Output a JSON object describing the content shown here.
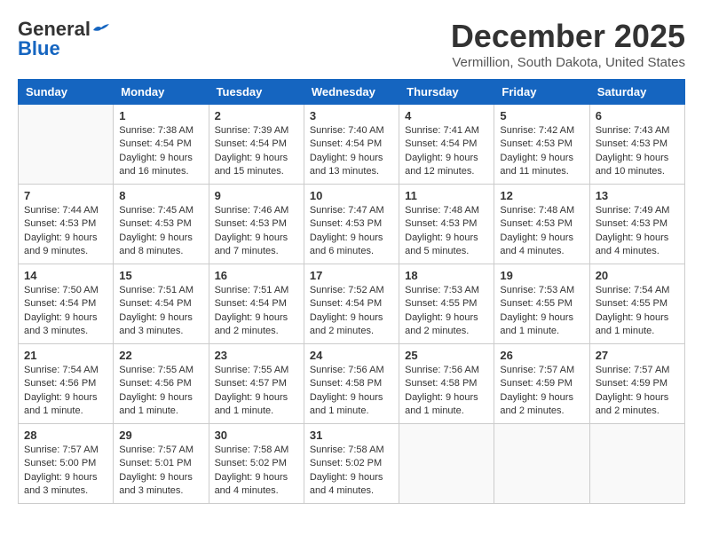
{
  "header": {
    "logo_general": "General",
    "logo_blue": "Blue",
    "month_title": "December 2025",
    "subtitle": "Vermillion, South Dakota, United States"
  },
  "days_of_week": [
    "Sunday",
    "Monday",
    "Tuesday",
    "Wednesday",
    "Thursday",
    "Friday",
    "Saturday"
  ],
  "weeks": [
    [
      {
        "day": "",
        "sunrise": "",
        "sunset": "",
        "daylight": ""
      },
      {
        "day": "1",
        "sunrise": "Sunrise: 7:38 AM",
        "sunset": "Sunset: 4:54 PM",
        "daylight": "Daylight: 9 hours and 16 minutes."
      },
      {
        "day": "2",
        "sunrise": "Sunrise: 7:39 AM",
        "sunset": "Sunset: 4:54 PM",
        "daylight": "Daylight: 9 hours and 15 minutes."
      },
      {
        "day": "3",
        "sunrise": "Sunrise: 7:40 AM",
        "sunset": "Sunset: 4:54 PM",
        "daylight": "Daylight: 9 hours and 13 minutes."
      },
      {
        "day": "4",
        "sunrise": "Sunrise: 7:41 AM",
        "sunset": "Sunset: 4:54 PM",
        "daylight": "Daylight: 9 hours and 12 minutes."
      },
      {
        "day": "5",
        "sunrise": "Sunrise: 7:42 AM",
        "sunset": "Sunset: 4:53 PM",
        "daylight": "Daylight: 9 hours and 11 minutes."
      },
      {
        "day": "6",
        "sunrise": "Sunrise: 7:43 AM",
        "sunset": "Sunset: 4:53 PM",
        "daylight": "Daylight: 9 hours and 10 minutes."
      }
    ],
    [
      {
        "day": "7",
        "sunrise": "Sunrise: 7:44 AM",
        "sunset": "Sunset: 4:53 PM",
        "daylight": "Daylight: 9 hours and 9 minutes."
      },
      {
        "day": "8",
        "sunrise": "Sunrise: 7:45 AM",
        "sunset": "Sunset: 4:53 PM",
        "daylight": "Daylight: 9 hours and 8 minutes."
      },
      {
        "day": "9",
        "sunrise": "Sunrise: 7:46 AM",
        "sunset": "Sunset: 4:53 PM",
        "daylight": "Daylight: 9 hours and 7 minutes."
      },
      {
        "day": "10",
        "sunrise": "Sunrise: 7:47 AM",
        "sunset": "Sunset: 4:53 PM",
        "daylight": "Daylight: 9 hours and 6 minutes."
      },
      {
        "day": "11",
        "sunrise": "Sunrise: 7:48 AM",
        "sunset": "Sunset: 4:53 PM",
        "daylight": "Daylight: 9 hours and 5 minutes."
      },
      {
        "day": "12",
        "sunrise": "Sunrise: 7:48 AM",
        "sunset": "Sunset: 4:53 PM",
        "daylight": "Daylight: 9 hours and 4 minutes."
      },
      {
        "day": "13",
        "sunrise": "Sunrise: 7:49 AM",
        "sunset": "Sunset: 4:53 PM",
        "daylight": "Daylight: 9 hours and 4 minutes."
      }
    ],
    [
      {
        "day": "14",
        "sunrise": "Sunrise: 7:50 AM",
        "sunset": "Sunset: 4:54 PM",
        "daylight": "Daylight: 9 hours and 3 minutes."
      },
      {
        "day": "15",
        "sunrise": "Sunrise: 7:51 AM",
        "sunset": "Sunset: 4:54 PM",
        "daylight": "Daylight: 9 hours and 3 minutes."
      },
      {
        "day": "16",
        "sunrise": "Sunrise: 7:51 AM",
        "sunset": "Sunset: 4:54 PM",
        "daylight": "Daylight: 9 hours and 2 minutes."
      },
      {
        "day": "17",
        "sunrise": "Sunrise: 7:52 AM",
        "sunset": "Sunset: 4:54 PM",
        "daylight": "Daylight: 9 hours and 2 minutes."
      },
      {
        "day": "18",
        "sunrise": "Sunrise: 7:53 AM",
        "sunset": "Sunset: 4:55 PM",
        "daylight": "Daylight: 9 hours and 2 minutes."
      },
      {
        "day": "19",
        "sunrise": "Sunrise: 7:53 AM",
        "sunset": "Sunset: 4:55 PM",
        "daylight": "Daylight: 9 hours and 1 minute."
      },
      {
        "day": "20",
        "sunrise": "Sunrise: 7:54 AM",
        "sunset": "Sunset: 4:55 PM",
        "daylight": "Daylight: 9 hours and 1 minute."
      }
    ],
    [
      {
        "day": "21",
        "sunrise": "Sunrise: 7:54 AM",
        "sunset": "Sunset: 4:56 PM",
        "daylight": "Daylight: 9 hours and 1 minute."
      },
      {
        "day": "22",
        "sunrise": "Sunrise: 7:55 AM",
        "sunset": "Sunset: 4:56 PM",
        "daylight": "Daylight: 9 hours and 1 minute."
      },
      {
        "day": "23",
        "sunrise": "Sunrise: 7:55 AM",
        "sunset": "Sunset: 4:57 PM",
        "daylight": "Daylight: 9 hours and 1 minute."
      },
      {
        "day": "24",
        "sunrise": "Sunrise: 7:56 AM",
        "sunset": "Sunset: 4:58 PM",
        "daylight": "Daylight: 9 hours and 1 minute."
      },
      {
        "day": "25",
        "sunrise": "Sunrise: 7:56 AM",
        "sunset": "Sunset: 4:58 PM",
        "daylight": "Daylight: 9 hours and 1 minute."
      },
      {
        "day": "26",
        "sunrise": "Sunrise: 7:57 AM",
        "sunset": "Sunset: 4:59 PM",
        "daylight": "Daylight: 9 hours and 2 minutes."
      },
      {
        "day": "27",
        "sunrise": "Sunrise: 7:57 AM",
        "sunset": "Sunset: 4:59 PM",
        "daylight": "Daylight: 9 hours and 2 minutes."
      }
    ],
    [
      {
        "day": "28",
        "sunrise": "Sunrise: 7:57 AM",
        "sunset": "Sunset: 5:00 PM",
        "daylight": "Daylight: 9 hours and 3 minutes."
      },
      {
        "day": "29",
        "sunrise": "Sunrise: 7:57 AM",
        "sunset": "Sunset: 5:01 PM",
        "daylight": "Daylight: 9 hours and 3 minutes."
      },
      {
        "day": "30",
        "sunrise": "Sunrise: 7:58 AM",
        "sunset": "Sunset: 5:02 PM",
        "daylight": "Daylight: 9 hours and 4 minutes."
      },
      {
        "day": "31",
        "sunrise": "Sunrise: 7:58 AM",
        "sunset": "Sunset: 5:02 PM",
        "daylight": "Daylight: 9 hours and 4 minutes."
      },
      {
        "day": "",
        "sunrise": "",
        "sunset": "",
        "daylight": ""
      },
      {
        "day": "",
        "sunrise": "",
        "sunset": "",
        "daylight": ""
      },
      {
        "day": "",
        "sunrise": "",
        "sunset": "",
        "daylight": ""
      }
    ]
  ]
}
